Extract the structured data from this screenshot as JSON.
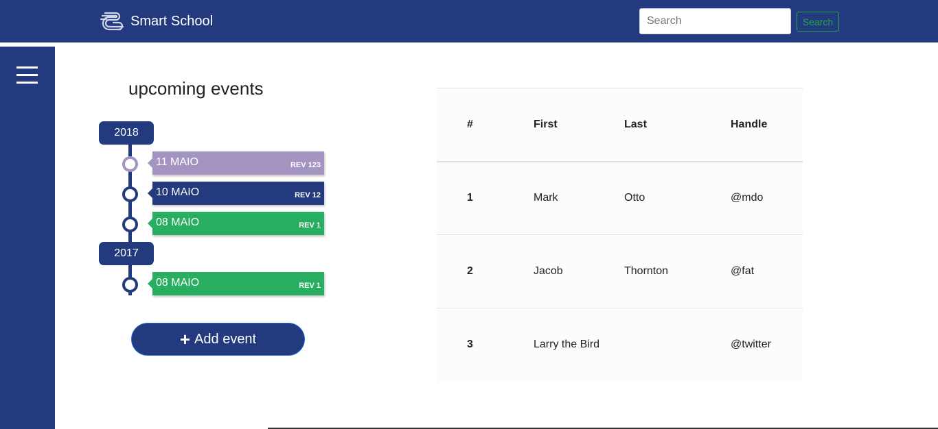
{
  "navbar": {
    "brand_name": "Smart School",
    "search_placeholder": "Search",
    "search_button_label": "Search"
  },
  "sidebar": {
    "menu_icon": "hamburger-menu-icon"
  },
  "events": {
    "title": "upcoming events",
    "years": [
      "2018",
      "2017"
    ],
    "items": [
      {
        "date": "11 MAIO",
        "rev": "REV 123",
        "color": "#a394c2"
      },
      {
        "date": "10 MAIO",
        "rev": "REV 12",
        "color": "#243a7e"
      },
      {
        "date": "08 MAIO",
        "rev": "REV 1",
        "color": "#27ae60"
      },
      {
        "date": "08 MAIO",
        "rev": "REV 1",
        "color": "#27ae60"
      }
    ],
    "add_button_label": "Add event",
    "add_icon": "plus-icon"
  },
  "table": {
    "headers": [
      "#",
      "First",
      "Last",
      "Handle"
    ],
    "rows": [
      [
        "1",
        "Mark",
        "Otto",
        "@mdo"
      ],
      [
        "2",
        "Jacob",
        "Thornton",
        "@fat"
      ],
      [
        "3",
        "Larry the Bird",
        "",
        "@twitter"
      ]
    ]
  },
  "colors": {
    "navy": "#243a7e",
    "lavender": "#a394c2",
    "green": "#27ae60"
  }
}
